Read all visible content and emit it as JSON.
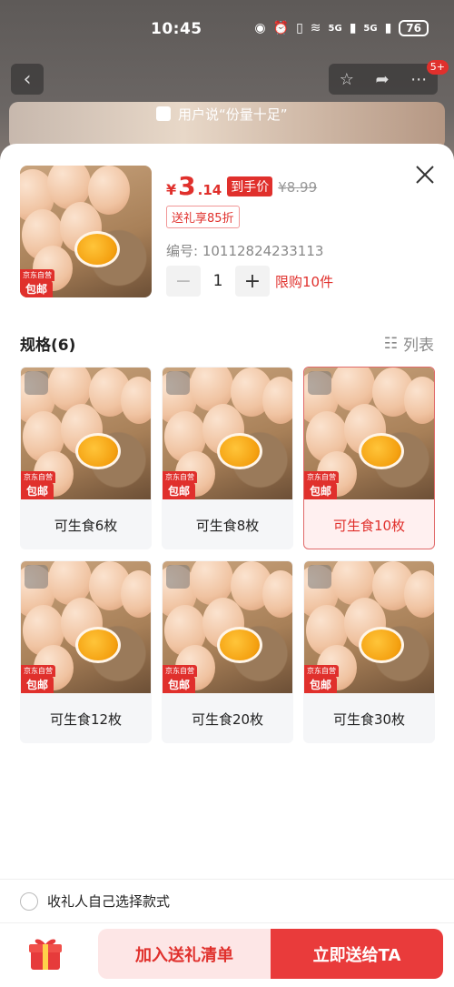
{
  "status_bar": {
    "time": "10:45",
    "battery": "76",
    "signal1": "5G",
    "signal2": "5G"
  },
  "header": {
    "review_text": "用户说“份量十足”",
    "message_count": "5+"
  },
  "product": {
    "currency": "¥",
    "price_int": "3",
    "price_dec": ".14",
    "price_tag": "到手价",
    "original_price": "¥8.99",
    "coupon": "送礼享85折",
    "sku_number": "编号: 10112824233113",
    "quantity": "1",
    "limit": "限购10件",
    "badge_jd": "京东自营",
    "badge_ship": "包邮"
  },
  "spec": {
    "title": "规格(6)",
    "list_toggle": "列表",
    "selected_index": 2,
    "options": [
      {
        "label": "可生食6枚"
      },
      {
        "label": "可生食8枚"
      },
      {
        "label": "可生食10枚"
      },
      {
        "label": "可生食12枚"
      },
      {
        "label": "可生食20枚"
      },
      {
        "label": "可生食30枚"
      }
    ]
  },
  "footer": {
    "recipient_choice": "收礼人自己选择款式",
    "add_to_gift_list": "加入送礼清单",
    "send_now": "立即送给TA"
  },
  "colors": {
    "accent": "#e0302c",
    "button_primary": "#e93b3b",
    "button_secondary_bg": "#fde6e6"
  }
}
